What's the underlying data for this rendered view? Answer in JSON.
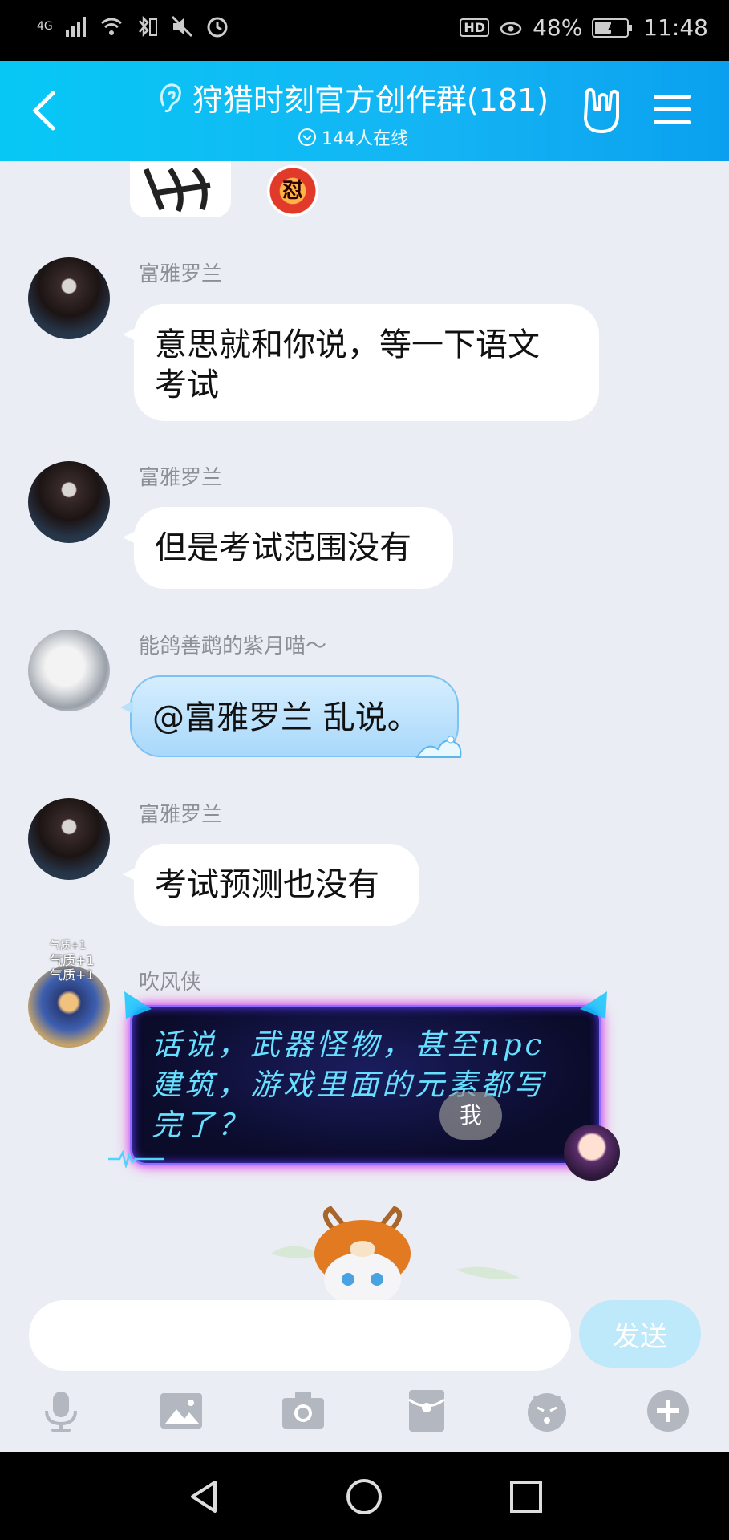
{
  "status_bar": {
    "network": "4G",
    "hd": "HD",
    "battery": "48%",
    "time": "11:48"
  },
  "header": {
    "title": "狩猎时刻官方创作群(181)",
    "online": "144人在线"
  },
  "chat": {
    "top_sticker_text": "怼",
    "messages": [
      {
        "sender": "富雅罗兰",
        "text_lines": [
          "意思就和你说，等一下语文",
          "考试"
        ]
      },
      {
        "sender": "富雅罗兰",
        "text": "但是考试范围没有"
      },
      {
        "sender": "能鸽善鹉的紫月喵～",
        "text": "@富雅罗兰 乱说。"
      },
      {
        "sender": "富雅罗兰",
        "text": "考试预测也没有"
      },
      {
        "sender": "吹风侠",
        "flair": [
          "气质+1",
          "气质+1",
          "气质+1"
        ],
        "text_lines": [
          "话说，武器怪物，甚至npc",
          "建筑，游戏里面的元素都写",
          "完了？"
        ]
      }
    ],
    "me_label": "我"
  },
  "input": {
    "placeholder": "",
    "send_label": "发送"
  },
  "toolbar": {
    "tools": [
      "microphone-icon",
      "image-icon",
      "camera-icon",
      "red-packet-icon",
      "emoji-icon",
      "plus-icon"
    ]
  },
  "colors": {
    "header_start": "#07c8f5",
    "header_end": "#0aa0ef",
    "chat_bg": "#eaedf4",
    "send_button": "#bde9fb"
  }
}
